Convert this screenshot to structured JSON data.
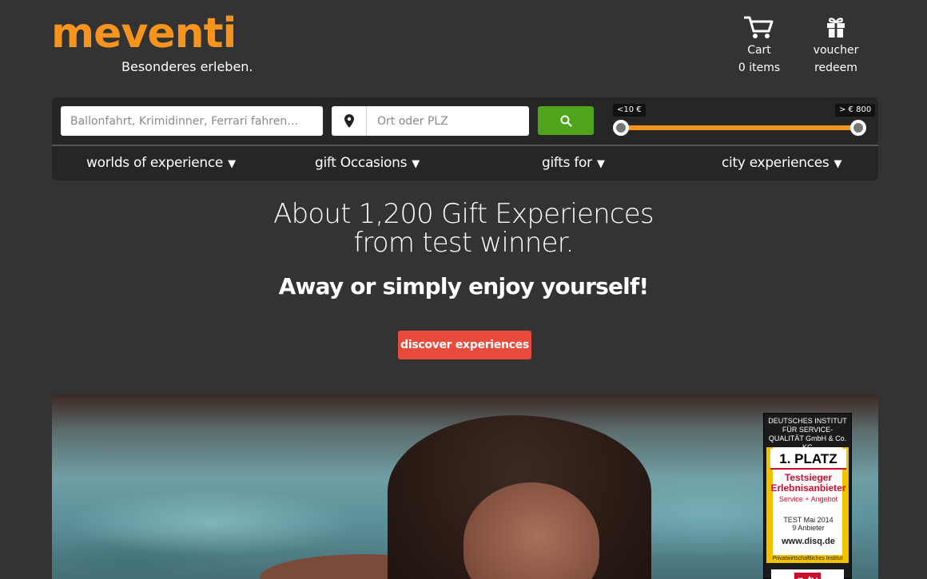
{
  "brand": {
    "logo_text": "meventi",
    "tagline": "Besonderes erleben.",
    "accent_color": "#f7941d"
  },
  "header": {
    "cart": {
      "icon": "cart-icon",
      "label": "Cart",
      "count_text": "0 items"
    },
    "voucher": {
      "icon": "gift-icon",
      "label": "voucher",
      "sub_label": "redeem"
    }
  },
  "search": {
    "placeholder": "Ballonfahrt, Krimidinner, Ferrari fahren…",
    "location_placeholder": "Ort oder PLZ",
    "location_icon": "map-pin-icon",
    "button_icon": "search-icon",
    "button_color": "#4ea51a",
    "price_min_label": "<10 €",
    "price_max_label": "> € 800"
  },
  "nav": {
    "items": [
      {
        "label": "worlds of experience",
        "caret": "▼"
      },
      {
        "label": "gift Occasions",
        "caret": "▼"
      },
      {
        "label": "gifts for",
        "caret": "▼"
      },
      {
        "label": "city experiences",
        "caret": "▼"
      }
    ]
  },
  "hero": {
    "title_line1": "About 1,200 Gift Experiences",
    "title_line2": "from test winner.",
    "subtitle": "Away or simply enjoy yourself!",
    "cta_label": "discover experiences",
    "cta_color": "#e84a3c"
  },
  "award": {
    "institute": "DEUTSCHES INSTITUT FÜR SERVICE-QUALITÄT GmbH & Co. KG",
    "rank": "1. PLATZ",
    "winner_line1": "Testsieger",
    "winner_line2": "Erlebnisanbieter",
    "category": "Service + Angebot",
    "test_line1": "TEST Mai 2014",
    "test_line2": "9 Anbieter",
    "site": "www.disq.de",
    "footer": "Privatwirtschaftliches Institut",
    "partner": "n-tv"
  }
}
